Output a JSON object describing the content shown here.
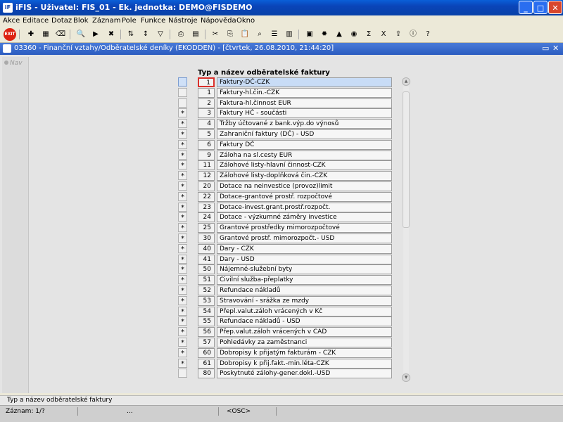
{
  "window": {
    "title": "iFIS - Uživatel: FIS_01 - Ek. jednotka: DEMO@FISDEMO",
    "icon": "iF",
    "controls": {
      "minimize": "_",
      "maximize": "□",
      "close": "✕"
    }
  },
  "menu": [
    "Akce",
    "Editace",
    "Dotaz",
    "Blok",
    "Záznam",
    "Pole",
    "Funkce",
    "Nástroje",
    "Nápověda",
    "Okno"
  ],
  "toolbar": {
    "exit_label": "EXIT"
  },
  "form": {
    "title": "03360 - Finanční vztahy/Odběratelské deníky (EKODDEN) - [čtvrtek, 26.08.2010, 21:44:20]"
  },
  "nav_label": "Nav",
  "column_header": "Typ a název odběratelské faktury",
  "rows": [
    {
      "mark": "",
      "code": "1",
      "name": "Faktury-DČ-CZK",
      "selected": true
    },
    {
      "mark": "",
      "code": "1",
      "name": "Faktury-hl.čin.-CZK"
    },
    {
      "mark": "",
      "code": "2",
      "name": "Faktura-hl.činnost EUR"
    },
    {
      "mark": "*",
      "code": "3",
      "name": "Faktury HČ - součásti"
    },
    {
      "mark": "*",
      "code": "4",
      "name": "Tržby účtované z bank.výp.do výnosů"
    },
    {
      "mark": "*",
      "code": "5",
      "name": "Zahraniční faktury (DČ) - USD"
    },
    {
      "mark": "*",
      "code": "6",
      "name": "Faktury DČ"
    },
    {
      "mark": "*",
      "code": "9",
      "name": "Záloha na sl.cesty EUR"
    },
    {
      "mark": "*",
      "code": "11",
      "name": "Zálohové listy-hlavní činnost-CZK"
    },
    {
      "mark": "*",
      "code": "12",
      "name": "Zálohové listy-doplňková čin.-CZK"
    },
    {
      "mark": "*",
      "code": "20",
      "name": "Dotace na neinvestice (provoz)limit"
    },
    {
      "mark": "*",
      "code": "22",
      "name": "Dotace-grantové prostř. rozpočtové"
    },
    {
      "mark": "*",
      "code": "23",
      "name": "Dotace-invest.grant.prostř.rozpočt."
    },
    {
      "mark": "*",
      "code": "24",
      "name": "Dotace - výzkumné záměry investice"
    },
    {
      "mark": "*",
      "code": "25",
      "name": "Grantové prostředky mimorozpočtové"
    },
    {
      "mark": "*",
      "code": "30",
      "name": "Grantové prostř. mimorozpočt.- USD"
    },
    {
      "mark": "*",
      "code": "40",
      "name": "Dary - CZK"
    },
    {
      "mark": "*",
      "code": "41",
      "name": "Dary - USD"
    },
    {
      "mark": "*",
      "code": "50",
      "name": "Nájemné-služební byty"
    },
    {
      "mark": "*",
      "code": "51",
      "name": "Civilní služba-přeplatky"
    },
    {
      "mark": "*",
      "code": "52",
      "name": "Refundace nákladů"
    },
    {
      "mark": "*",
      "code": "53",
      "name": "Stravování - srážka ze mzdy"
    },
    {
      "mark": "*",
      "code": "54",
      "name": "Přepl.valut.záloh vrácených v Kč"
    },
    {
      "mark": "*",
      "code": "55",
      "name": "Refundace nákladů - USD"
    },
    {
      "mark": "*",
      "code": "56",
      "name": "Přep.valut.záloh vrácených v CAD"
    },
    {
      "mark": "*",
      "code": "57",
      "name": "Pohledávky za zaměstnanci"
    },
    {
      "mark": "*",
      "code": "60",
      "name": "Dobropisy k přijatým fakturám - CZK"
    },
    {
      "mark": "*",
      "code": "61",
      "name": "Dobropisy k přij.fakt.-min.léta-CZK"
    },
    {
      "mark": "",
      "code": "80",
      "name": "Poskytnuté zálohy-gener.dokl.-USD"
    }
  ],
  "hint": "Typ a název odběratelské faktury",
  "status": {
    "record": "Záznam: 1/?",
    "ellipsis": "...",
    "osc": "<OSC>"
  },
  "colors": {
    "title_blue": "#0a4cc4",
    "selected_row": "#c8dcf6",
    "current_cell_border": "#d9302c"
  }
}
